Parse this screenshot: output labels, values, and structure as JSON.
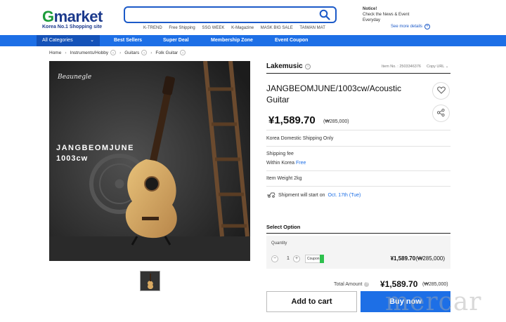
{
  "header": {
    "logo_g": "G",
    "logo_rest": "market",
    "logo_sub": "Korea No.1 Shopping site",
    "search": {
      "value": "",
      "placeholder": ""
    },
    "quick_links": [
      "K-TREND",
      "Free Shipping",
      "SSG WEEK",
      "K-Magazine",
      "MASK BIG SALE",
      "TAIWAN MAT"
    ],
    "notice_title": "Notice!",
    "notice_line1": "Check the News & Event",
    "notice_line2": "Everyday",
    "see_more": "See more details"
  },
  "nav": {
    "all_categories": "All Categories",
    "items": [
      "Best Sellers",
      "Super Deal",
      "Membership Zone",
      "Event Coupon"
    ]
  },
  "breadcrumb": [
    "Home",
    "Instruments/Hobby",
    "Guitars",
    "Folk Guitar"
  ],
  "product_image": {
    "brand_script": "Beaunegle",
    "overlay_line1": "JANGBEOMJUNE",
    "overlay_line2": "1003cw"
  },
  "product": {
    "seller": "Lakemusic",
    "item_no": "Item No. : 2503346376",
    "copy_url": "Copy URL",
    "title": "JANGBEOMJUNE/1003cw/Acoustic Guitar",
    "price": "¥1,589.70",
    "price_krw": "(₩285,000)",
    "shipping_type": "Korea Domestic Shipping Only",
    "shipping_fee_label": "Shipping fee",
    "shipping_within": "Within Korea",
    "shipping_free": "Free",
    "item_weight_label": "Item Weight",
    "item_weight": "2kg",
    "shipment_text": "Shipment will start on",
    "shipment_date": "Oct. 17th (Tue)"
  },
  "option": {
    "select_label": "Select Option",
    "quantity_label": "Quantity",
    "quantity": "1",
    "coupon_label": "Coupon",
    "price": "¥1,589.70",
    "price_krw": "(₩285,000)"
  },
  "total": {
    "label": "Total Amount",
    "price": "¥1,589.70",
    "price_krw": "(₩285,000)"
  },
  "actions": {
    "add_to_cart": "Add to cart",
    "buy_now": "Buy now"
  },
  "watermark": "mercar",
  "colors": {
    "brand_blue": "#1d6fe6",
    "logo_green": "#1c9c3a",
    "logo_navy": "#1c3a8c"
  }
}
